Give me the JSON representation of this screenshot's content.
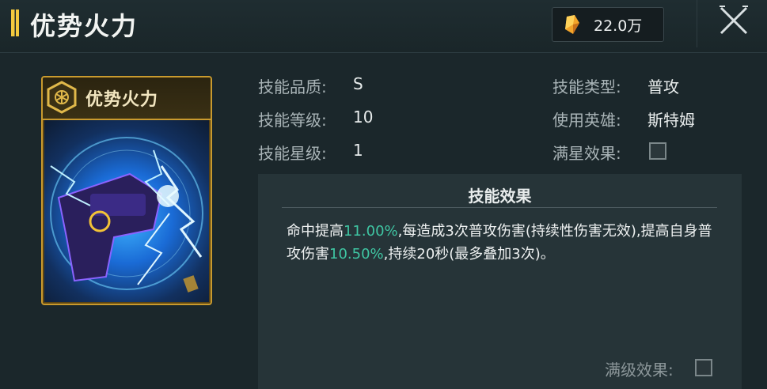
{
  "header": {
    "title": "优势火力",
    "currency": {
      "icon": "crystal-icon",
      "value": "22.0万"
    }
  },
  "card": {
    "name": "优势火力",
    "emblem": "hex-emblem-icon"
  },
  "info": {
    "quality_label": "技能品质:",
    "quality_value": "S",
    "level_label": "技能等级:",
    "level_value": "10",
    "star_label": "技能星级:",
    "star_value": "1",
    "type_label": "技能类型:",
    "type_value": "普攻",
    "hero_label": "使用英雄:",
    "hero_value": "斯特姆",
    "maxstar_label": "满星效果:"
  },
  "effect": {
    "title": "技能效果",
    "text_1": "命中提高",
    "hl_1": "11.00%",
    "text_2": ",每造成3次普攻伤害(持续性伤害无效),提高自身普攻伤害",
    "hl_2": "10.50%",
    "text_3": ",持续20秒(最多叠加3次)。",
    "maxlevel_label": "满级效果:"
  },
  "colors": {
    "background": "#1b272b",
    "panel": "#263438",
    "highlight": "#3fc6a3",
    "gold": "#c99a2e"
  }
}
